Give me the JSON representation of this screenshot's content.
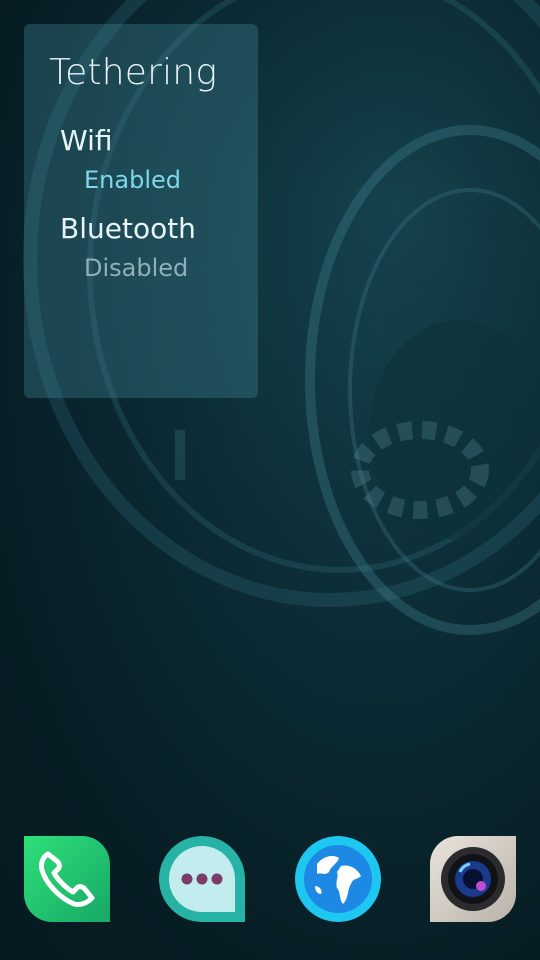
{
  "cover": {
    "title": "Tethering",
    "wifi": {
      "label": "Wifi",
      "status": "Enabled"
    },
    "bluetooth": {
      "label": "Bluetooth",
      "status": "Disabled"
    }
  },
  "dock": {
    "apps": [
      {
        "name": "phone",
        "icon": "phone-icon",
        "color": "#2ecc71"
      },
      {
        "name": "messages",
        "icon": "chat-bubble-icon",
        "color": "#26b3a6"
      },
      {
        "name": "browser",
        "icon": "globe-icon",
        "color": "#1e9ee6"
      },
      {
        "name": "camera",
        "icon": "camera-lens-icon",
        "color": "#c9c3bb"
      }
    ]
  },
  "colors": {
    "accent": "#7fd7ea",
    "text_primary": "#e8f4f6",
    "text_secondary": "#8fb0b8"
  }
}
